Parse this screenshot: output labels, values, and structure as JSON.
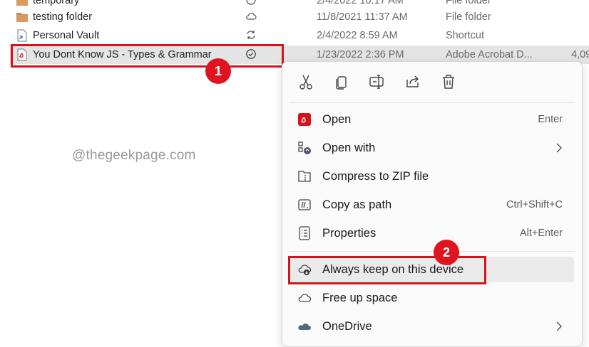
{
  "files": [
    {
      "name": "temporary",
      "date": "2/4/2022 10:17 AM",
      "type": "File folder",
      "size": ""
    },
    {
      "name": "testing folder",
      "date": "11/8/2021 11:37 AM",
      "type": "File folder",
      "size": ""
    },
    {
      "name": "Personal Vault",
      "date": "2/4/2022 8:59 AM",
      "type": "Shortcut",
      "size": ""
    },
    {
      "name": "You Dont Know JS - Types & Grammar",
      "date": "1/23/2022 2:36 PM",
      "type": "Adobe Acrobat D...",
      "size": "4,09"
    }
  ],
  "watermark": "@thegeekpage.com",
  "annotations": {
    "step1": "1",
    "step2": "2"
  },
  "toolbar": {
    "cut_icon": "scissors-icon",
    "copy_icon": "copy-icon",
    "rename_icon": "rename-icon",
    "share_icon": "share-icon",
    "delete_icon": "trash-icon"
  },
  "menu": {
    "open": {
      "label": "Open",
      "shortcut": "Enter"
    },
    "open_with": {
      "label": "Open with"
    },
    "compress": {
      "label": "Compress to ZIP file"
    },
    "copy_path": {
      "label": "Copy as path",
      "shortcut": "Ctrl+Shift+C"
    },
    "properties": {
      "label": "Properties",
      "shortcut": "Alt+Enter"
    },
    "always_keep": {
      "label": "Always keep on this device"
    },
    "free_up": {
      "label": "Free up space"
    },
    "onedrive": {
      "label": "OneDrive"
    }
  },
  "colors": {
    "accent_red": "#d4141c",
    "folder": "#c98850",
    "selection": "#e4e4e4"
  }
}
